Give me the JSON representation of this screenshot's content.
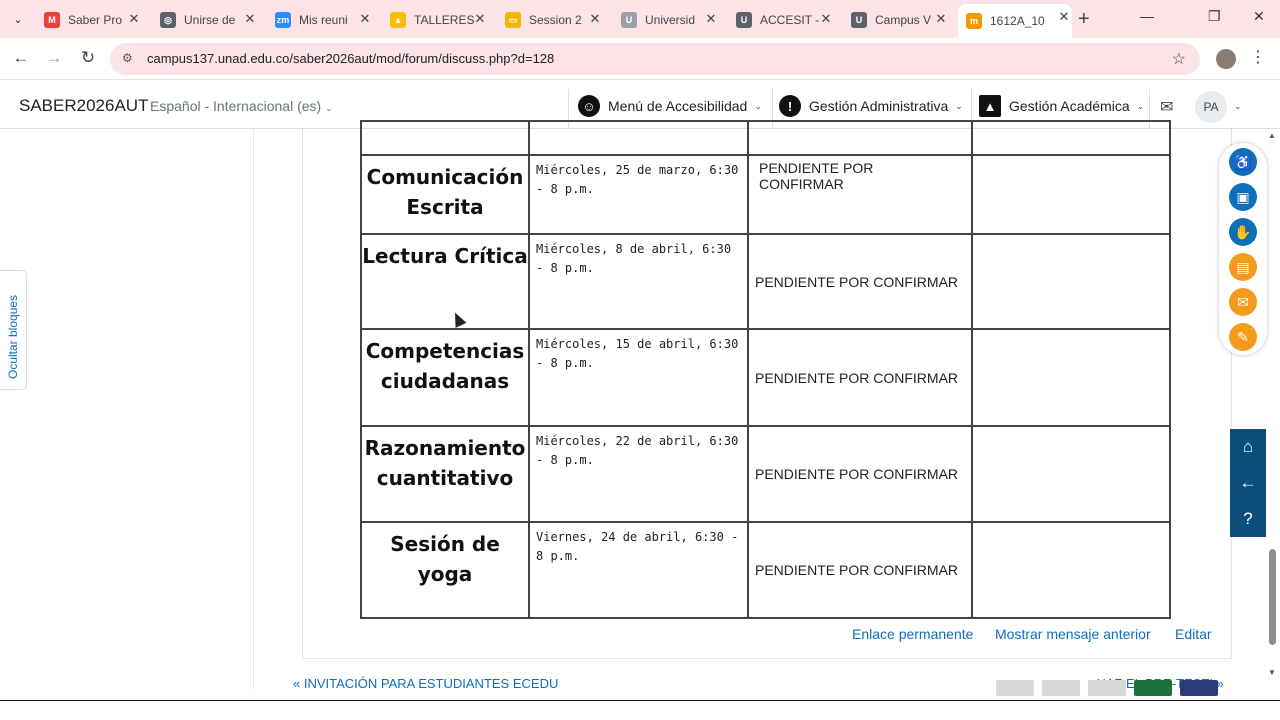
{
  "browser": {
    "tabs": [
      {
        "title": "Saber Pro",
        "fav_color": "#ea4335",
        "fav_text": "M"
      },
      {
        "title": "Unirse de",
        "fav_color": "#5f6368",
        "fav_text": "◎"
      },
      {
        "title": "Mis reuni",
        "fav_color": "#2d8cff",
        "fav_text": "zm"
      },
      {
        "title": "TALLERES",
        "fav_color": "#fbbc04",
        "fav_text": "▲"
      },
      {
        "title": "Session 2",
        "fav_color": "#f4b400",
        "fav_text": "▭"
      },
      {
        "title": "Universid",
        "fav_color": "#9aa0a6",
        "fav_text": "U"
      },
      {
        "title": "ACCESIT -",
        "fav_color": "#5f6368",
        "fav_text": "U"
      },
      {
        "title": "Campus V",
        "fav_color": "#5f6368",
        "fav_text": "U"
      },
      {
        "title": "1612A_10",
        "fav_color": "#f29900",
        "fav_text": "m"
      }
    ],
    "url": "campus137.unad.edu.co/saber2026aut/mod/forum/discuss.php?d=128"
  },
  "navbar": {
    "brand": "SABER2026AUT",
    "language": "Español - Internacional (es)",
    "menus": [
      {
        "label": "Menú de Accesibilidad",
        "icon": "accessibility-icon"
      },
      {
        "label": "Gestión Administrativa",
        "icon": "alert-icon"
      },
      {
        "label": "Gestión Académica",
        "icon": "graduation-cap-icon"
      }
    ],
    "user_initials": "PA"
  },
  "sidebar": {
    "toggle_label": "Ocultar bloques"
  },
  "schedule": {
    "rows": [
      {
        "subject": "Comunicación Escrita",
        "date": "Miércoles, 25 de marzo, 6:30 - 8 p.m.",
        "status": "PENDIENTE POR CONFIRMAR",
        "status_align": "top"
      },
      {
        "subject": "Lectura Crítica",
        "date": "Miércoles, 8 de abril, 6:30 - 8 p.m.",
        "status": "PENDIENTE POR CONFIRMAR",
        "status_align": "middle"
      },
      {
        "subject": "Competencias ciudadanas",
        "date": "Miércoles, 15 de abril, 6:30 - 8 p.m.",
        "status": "PENDIENTE POR CONFIRMAR",
        "status_align": "middle"
      },
      {
        "subject": "Razonamiento cuantitativo",
        "date": "Miércoles, 22 de abril, 6:30 - 8 p.m.",
        "status": "PENDIENTE POR CONFIRMAR",
        "status_align": "middle"
      },
      {
        "subject": "Sesión de yoga",
        "date": "Viernes, 24 de abril, 6:30 - 8 p.m.",
        "status": "PENDIENTE POR CONFIRMAR",
        "status_align": "middle"
      }
    ]
  },
  "post_actions": {
    "permalink": "Enlace permanente",
    "show_parent": "Mostrar mensaje anterior",
    "edit": "Editar"
  },
  "discussion_nav": {
    "prev": "« INVITACIÓN PARA ESTUDIANTES ECEDU",
    "next": "¡HAZ EL PRE-TEST! »"
  },
  "colors": {
    "link": "#0f6cbf",
    "accent_orange": "#f59b1b",
    "accent_blue": "#0d6fb8",
    "quick_panel": "#0b4f7a"
  }
}
